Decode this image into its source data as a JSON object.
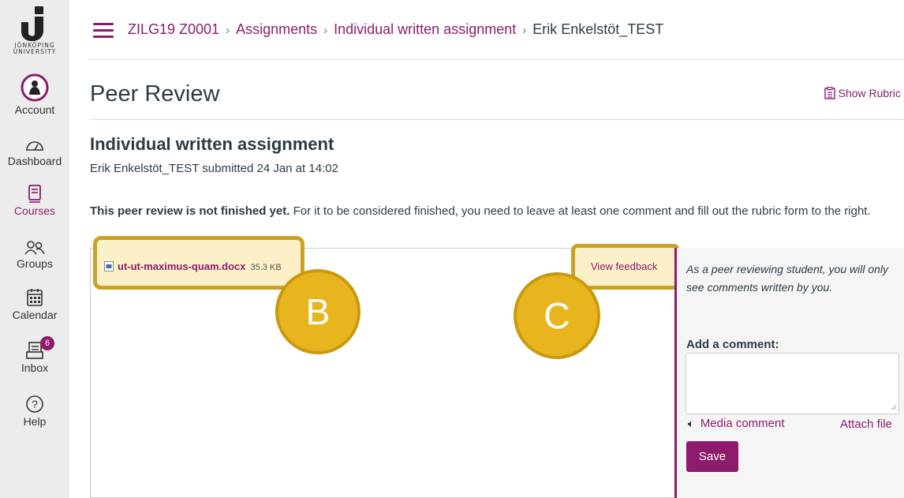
{
  "logo": {
    "text_line1": "JÖNKÖPING",
    "text_line2": "UNIVERSITY"
  },
  "global_nav": {
    "account": "Account",
    "dashboard": "Dashboard",
    "courses": "Courses",
    "groups": "Groups",
    "calendar": "Calendar",
    "inbox": "Inbox",
    "inbox_badge": "6",
    "help": "Help",
    "active": "Courses"
  },
  "breadcrumb": {
    "course": "ZILG19 Z0001",
    "section": "Assignments",
    "assignment": "Individual written assignment",
    "current": "Erik Enkelstöt_TEST",
    "separator": "›"
  },
  "page": {
    "title": "Peer Review",
    "show_rubric": "Show Rubric",
    "assignment_title": "Individual written assignment",
    "submitted_line": "Erik Enkelstöt_TEST submitted 24 Jan at 14:02",
    "notice_bold": "This peer review is not finished yet.",
    "notice_rest": " For it to be considered finished, you need to leave at least one comment and fill out the rubric form to the right."
  },
  "preview": {
    "file_name": "ut-ut-maximus-quam.docx",
    "file_size": "35.3 KB",
    "view_feedback": "View feedback"
  },
  "callouts": {
    "b": "B",
    "c": "C"
  },
  "comment_panel": {
    "note": "As a peer reviewing student, you will only see comments written by you.",
    "add_comment_label": "Add a comment:",
    "media_comment": "Media comment",
    "attach_file": "Attach file",
    "save": "Save"
  },
  "colors": {
    "brand": "#8d1b6c",
    "highlight_border": "#c9a227",
    "highlight_fill": "#fbf0c8",
    "callout_fill": "#e9b51e"
  }
}
